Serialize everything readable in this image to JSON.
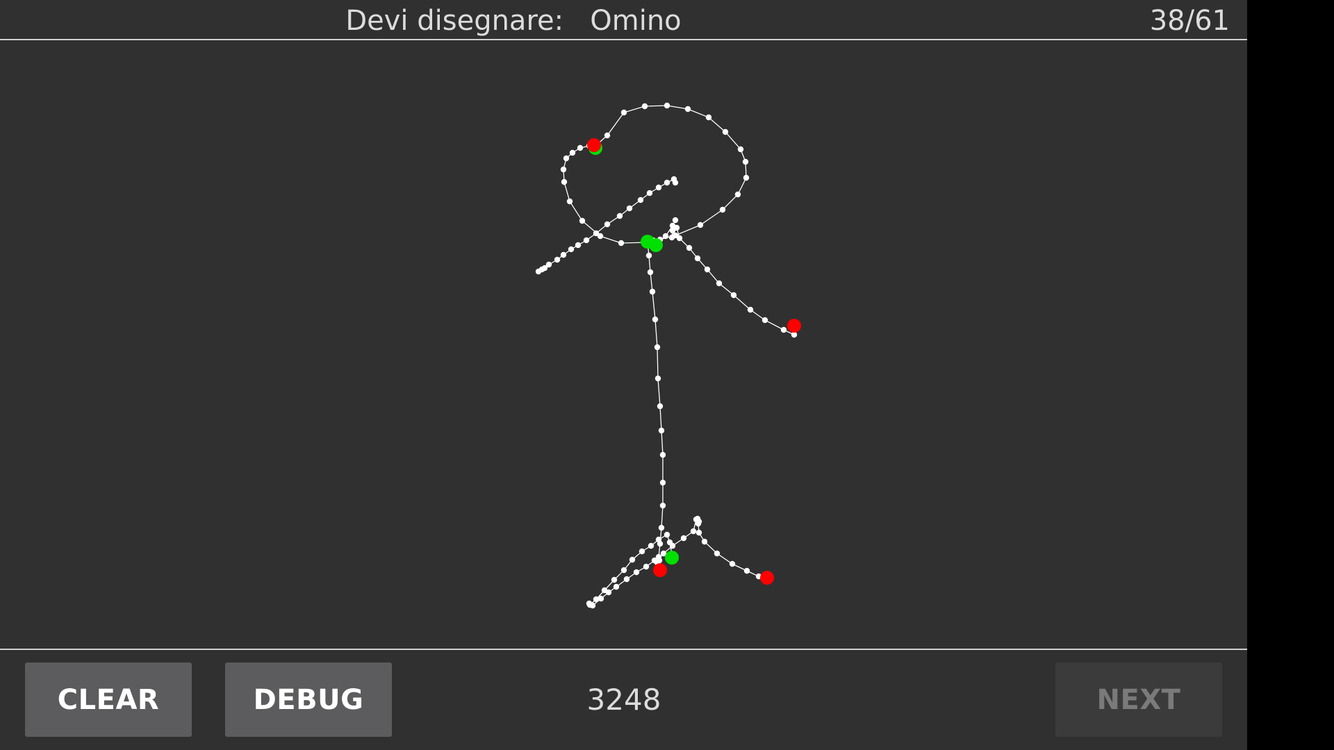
{
  "header": {
    "prompt_label": "Devi disegnare:",
    "subject": "Omino",
    "progress": "38/61"
  },
  "toolbar": {
    "clear_label": "CLEAR",
    "debug_label": "DEBUG",
    "score": "3248",
    "next_label": "NEXT",
    "next_enabled": false
  },
  "colors": {
    "background": "#303030",
    "stroke": "#ffffff",
    "stroke_start": "#00e000",
    "stroke_end": "#ff0000"
  }
}
